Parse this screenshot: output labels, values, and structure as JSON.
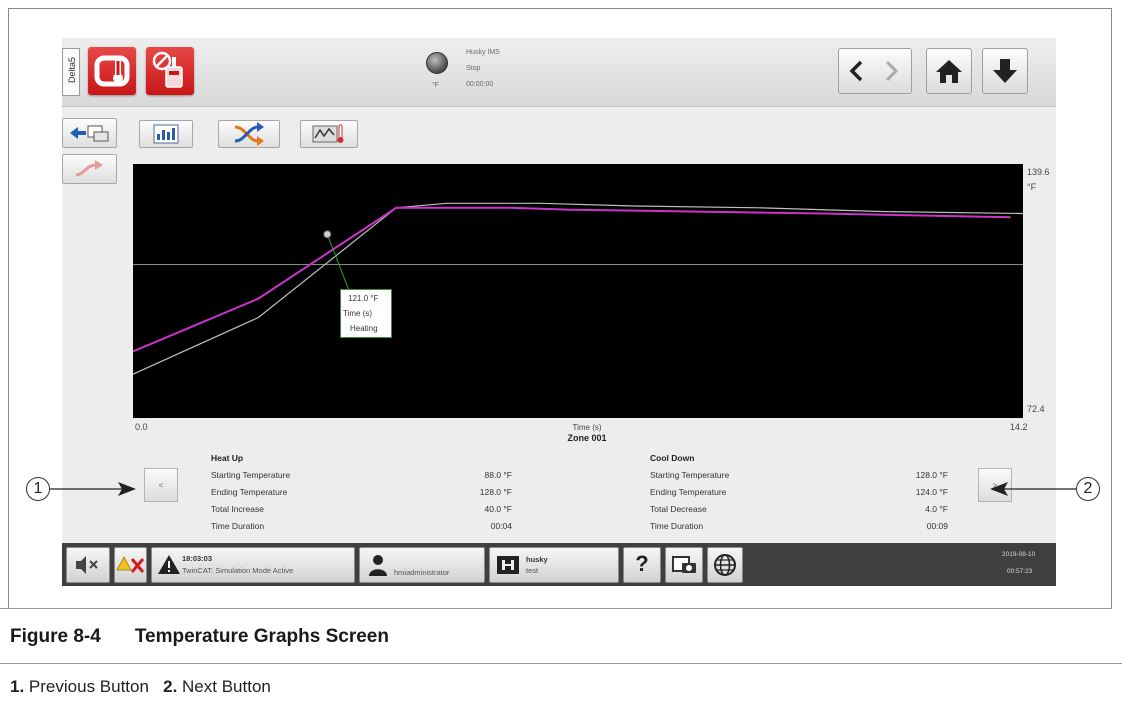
{
  "header": {
    "side_tab": "Delta5",
    "status_title": "Husky IMS",
    "status_state": "Stop",
    "status_time": "00:00:00",
    "status_unit": "°F"
  },
  "chart_data": {
    "type": "line",
    "xlabel": "Time (s)",
    "zone_label": "Zone 001",
    "x_min": "0.0",
    "x_max": "14.2",
    "y_max_label": "139.6",
    "y_unit": "°F",
    "y_min_label": "72.4",
    "xlim": [
      0,
      14.2
    ],
    "ylim": [
      72.4,
      139.6
    ],
    "series": [
      {
        "color": "#cc33cc",
        "x": [
          0,
          2.0,
          4.2,
          6.0,
          7.0,
          9.0,
          11.0,
          14.0
        ],
        "y": [
          90,
          104,
          128,
          128,
          127.5,
          127,
          126.5,
          125.5
        ]
      },
      {
        "color": "#bfbfbf",
        "x": [
          0,
          2.0,
          4.2,
          5.0,
          6.5,
          8.0,
          10.0,
          12.0,
          14.2
        ],
        "y": [
          84,
          99,
          128,
          129.2,
          129.2,
          128.5,
          128,
          127,
          126.5
        ]
      }
    ],
    "reference_line_y": 113,
    "tooltip": {
      "value": "121.0 °F",
      "label": "Time (s)",
      "state": "Heating",
      "x": 3.1,
      "y": 121
    }
  },
  "summary": {
    "heat": {
      "title": "Heat Up",
      "rows": [
        {
          "label": "Starting Temperature",
          "value": "88.0 °F"
        },
        {
          "label": "Ending Temperature",
          "value": "128.0 °F"
        },
        {
          "label": "Total Increase",
          "value": "40.0 °F"
        },
        {
          "label": "Time Duration",
          "value": "00:04"
        }
      ]
    },
    "cool": {
      "title": "Cool Down",
      "rows": [
        {
          "label": "Starting Temperature",
          "value": "128.0 °F"
        },
        {
          "label": "Ending Temperature",
          "value": "124.0 °F"
        },
        {
          "label": "Total Decrease",
          "value": "4.0 °F"
        },
        {
          "label": "Time Duration",
          "value": "00:09"
        }
      ]
    },
    "prev_label": "<",
    "next_label": ">"
  },
  "footer": {
    "alarm_time": "18:03:03",
    "alarm_text": "TwinCAT: Simulation Mode Active",
    "user": "hmiadministrator",
    "mold_name": "husky",
    "mold_sub": "test",
    "help": "?",
    "date": "2019-08-10",
    "clock": "00:57:23"
  },
  "annotations": {
    "prev_marker": "1",
    "next_marker": "2"
  },
  "caption": {
    "figure_number": "Figure 8-4",
    "figure_title": "Temperature Graphs Screen",
    "item1_num": "1.",
    "item1_text": "Previous Button",
    "item2_num": "2.",
    "item2_text": "Next Button"
  }
}
